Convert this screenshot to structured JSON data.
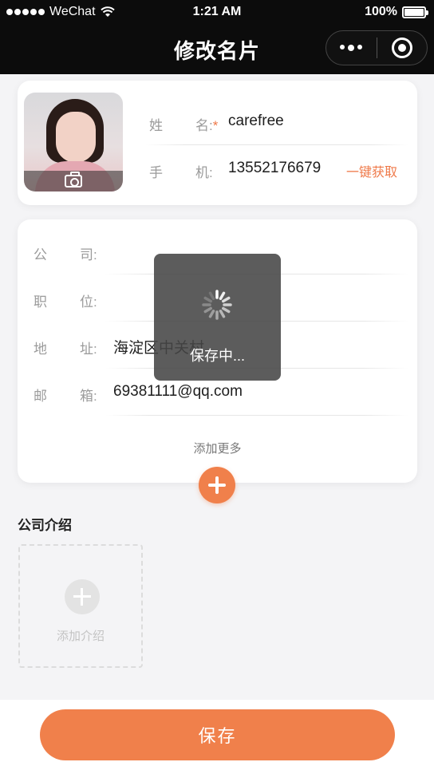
{
  "status_bar": {
    "carrier": "WeChat",
    "time": "1:21 AM",
    "battery": "100%"
  },
  "nav": {
    "title": "修改名片"
  },
  "profile": {
    "name_label_1": "姓",
    "name_label_2": "名:",
    "required_mark": "*",
    "name_value": "carefree",
    "phone_label_1": "手",
    "phone_label_2": "机:",
    "phone_value": "13552176679",
    "get_phone_link": "一键获取"
  },
  "details": {
    "rows": [
      {
        "label_1": "公",
        "label_2": "司:",
        "value": ""
      },
      {
        "label_1": "职",
        "label_2": "位:",
        "value": ""
      },
      {
        "label_1": "地",
        "label_2": "址:",
        "value": "海淀区中关村"
      },
      {
        "label_1": "邮",
        "label_2": "箱:",
        "value": "69381111@qq.com"
      }
    ],
    "add_more": "添加更多"
  },
  "intro": {
    "title": "公司介绍",
    "add_label": "添加介绍"
  },
  "footer": {
    "save_label": "保存"
  },
  "toast": {
    "text": "保存中..."
  },
  "colors": {
    "accent": "#f0804b",
    "nav_bg": "#0c0c0c",
    "page_bg": "#f4f4f6"
  }
}
